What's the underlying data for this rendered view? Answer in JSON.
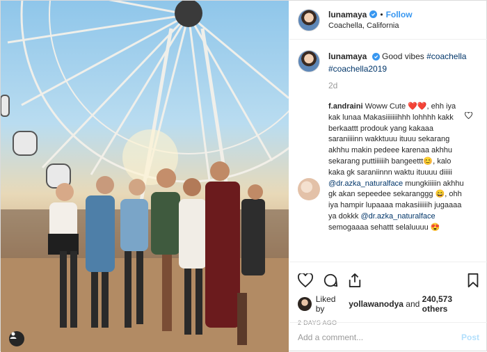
{
  "header": {
    "username": "lunamaya",
    "separator": "•",
    "follow_label": "Follow",
    "location": "Coachella, California"
  },
  "caption": {
    "username": "lunamaya",
    "text": "Good vibes",
    "hashtag1": "#coachella",
    "hashtag2": "#coachella2019",
    "time": "2d"
  },
  "comment": {
    "username": "f.andraini",
    "part1": "Woww Cute",
    "emoji1": "❤️❤️",
    "part2": ", ehh iya kak lunaa Makasiiiiiiihhh lohhhh kakk berkaattt prodouk yang kakaaa saraniiiinn wakktuuu ituuu sekarang akhhu makin pedeee karenaa akhhu sekarang puttiiiiiih bangeettt",
    "emoji2": "😊",
    "part3": ", kalo kaka gk saraniinnn waktu ituuuu diiiii",
    "mention1": "@dr.azka_naturalface",
    "part4": "mungkiiiiin akhhu gk akan sepeedee sekaranggg",
    "emoji3": "😄",
    "part5": ", ohh iya hampir lupaaaa makasiiiiiih jugaaaa ya dokkk",
    "mention2": "@dr.azka_naturalface",
    "part6": "semogaaaa sehattt selaluuuu",
    "emoji4": "😍"
  },
  "likes": {
    "prefix": "Liked by",
    "user": "yollawanodya",
    "connector": "and",
    "count": "240,573 others"
  },
  "date": "2 DAYS AGO",
  "add_comment": {
    "placeholder": "Add a comment...",
    "post_label": "Post"
  },
  "colors": {
    "link_blue": "#3897f0",
    "hashtag": "#003569",
    "muted": "#999999",
    "heart_red": "#e0245e"
  },
  "icons": [
    "verified-badge-icon",
    "heart-outline-icon",
    "comment-icon",
    "share-icon",
    "bookmark-icon",
    "user-tag-icon"
  ]
}
